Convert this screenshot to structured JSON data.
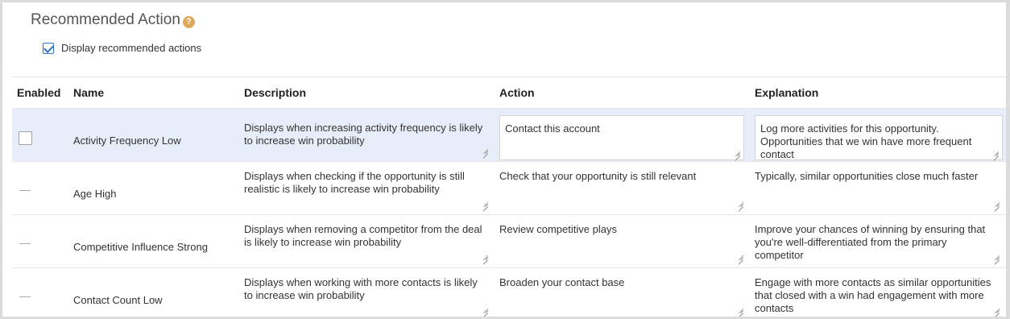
{
  "header": {
    "title": "Recommended Action",
    "help_icon": "question-icon",
    "help_glyph": "?",
    "accent_color": "#e0a85a"
  },
  "display_option": {
    "label": "Display recommended actions",
    "checked": true
  },
  "table": {
    "columns": [
      "Enabled",
      "Name",
      "Description",
      "Action",
      "Explanation"
    ],
    "rows": [
      {
        "enabled": "unchecked",
        "name": "Activity Frequency Low",
        "description": "Displays when increasing activity frequency is likely to increase win probability",
        "action": "Contact this account",
        "explanation": "Log more activities for this opportunity. Opportunities that we win have more frequent contact",
        "selected": true
      },
      {
        "enabled": "dash",
        "name": "Age High",
        "description": "Displays when checking if the opportunity is still realistic is likely to increase win probability",
        "action": "Check that your opportunity is still relevant",
        "explanation": "Typically, similar opportunities close much faster",
        "selected": false
      },
      {
        "enabled": "dash",
        "name": "Competitive Influence Strong",
        "description": "Displays when removing a competitor from the deal is likely to increase win probability",
        "action": "Review competitive plays",
        "explanation": "Improve your chances of winning by ensuring that you're well-differentiated from the primary competitor",
        "selected": false
      },
      {
        "enabled": "dash",
        "name": "Contact Count Low",
        "description": "Displays when working with more contacts is likely to increase win probability",
        "action": "Broaden your contact base",
        "explanation": "Engage with more contacts as similar opportunities that closed with a win had engagement with more contacts",
        "selected": false
      }
    ]
  }
}
